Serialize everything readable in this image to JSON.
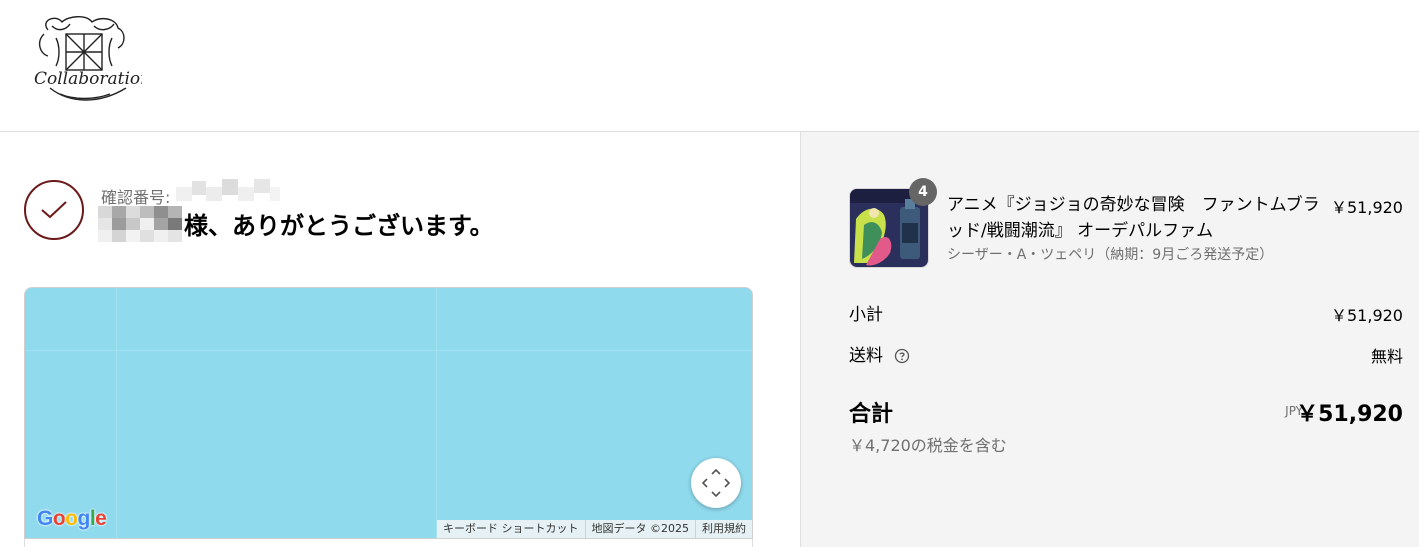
{
  "brand": {
    "logo_text": "Collaboration"
  },
  "confirmation": {
    "label": "確認番号:",
    "thanks": "様、ありがとうございます。"
  },
  "map": {
    "google_text": "Google",
    "footer": [
      "キーボード ショートカット",
      "地図データ ©2025",
      "利用規約"
    ]
  },
  "order_summary": {
    "item": {
      "quantity": "4",
      "title": "アニメ『ジョジョの奇妙な冒険　ファントムブラッド/戦闘潮流』 オーデパルファム",
      "variant": "シーザー・A・ツェペリ（納期：9月ごろ発送予定）",
      "price": "￥51,920"
    },
    "subtotal_label": "小計",
    "subtotal_value": "￥51,920",
    "shipping_label": "送料",
    "shipping_value": "無料",
    "total_label": "合計",
    "currency": "JPY",
    "total_value": "￥51,920",
    "tax_note": "￥4,720の税金を含む"
  },
  "colors": {
    "accent": "#6b1a1a",
    "map_water": "#8fdaed",
    "sidebar_bg": "#f4f4f4"
  }
}
